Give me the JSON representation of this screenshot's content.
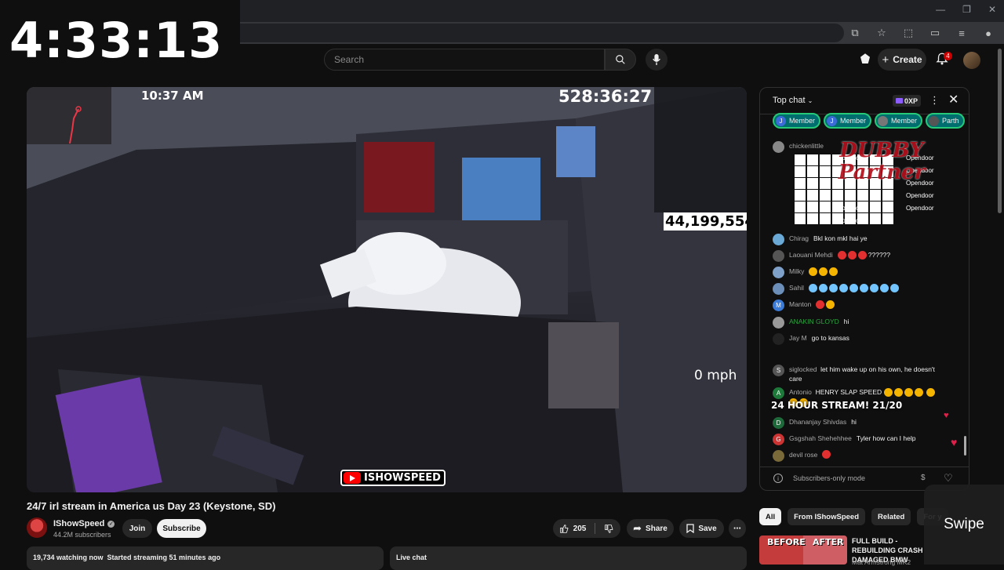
{
  "timer": "4:33:13",
  "header": {
    "search_placeholder": "Search",
    "create_label": "Create",
    "notification_count": "4"
  },
  "video": {
    "clock": "10:37 AM",
    "uptime": "528:36:27",
    "counter": "44,199,554",
    "speed": "0 mph",
    "logo_text": "ISHOWSPEED",
    "title": "24/7 irl stream in America us Day 23 (Keystone, SD)"
  },
  "channel": {
    "name": "IShowSpeed",
    "subscribers": "44.2M subscribers",
    "join_label": "Join",
    "subscribe_label": "Subscribe"
  },
  "actions": {
    "like_count": "205",
    "share_label": "Share",
    "save_label": "Save"
  },
  "description": {
    "stats": "19,734 watching now  Started streaming 51 minutes ago"
  },
  "livechat_label": "Live chat",
  "chat": {
    "title": "Top chat",
    "xp": "0XP",
    "chips": [
      "Member",
      "Member",
      "Member",
      "Parth"
    ],
    "messages": [
      {
        "author": "chickenlittle",
        "text": ""
      },
      {
        "author": "Chirag",
        "text": "Bkl kon mkl hai ye"
      },
      {
        "author": "Laouani Mehdi",
        "text": "??????"
      },
      {
        "author": "Milky",
        "text": ""
      },
      {
        "author": "Sahil",
        "text": ""
      },
      {
        "author": "Manton",
        "text": ""
      },
      {
        "author": "ANAKIN GLOYD",
        "text": "hi"
      },
      {
        "author": "Jay M",
        "text": "go to kansas"
      },
      {
        "author": "siglocked",
        "text": "let him wake up on his own, he doesn't care"
      },
      {
        "author": "Antonio",
        "text": "HENRY SLAP SPEED"
      },
      {
        "author": "Dhananjay Shivdas",
        "text": "hi"
      },
      {
        "author": "Gsgshah Shehehhee",
        "text": "Tyler how can I help"
      },
      {
        "author": "devil rose",
        "text": ""
      }
    ],
    "opendoor": "Opendoor",
    "partner_art": "DUBBY Partner",
    "banner": "24 HOUR STREAM! 21/20",
    "footer": "Subscribers-only mode"
  },
  "related": {
    "chips": [
      "All",
      "From IShowSpeed",
      "Related",
      "For y"
    ],
    "thumb_left": "BEFORE",
    "thumb_right": "AFTER",
    "title": "FULL BUILD - REBUILDING CRASH DAMAGED BMW",
    "channel": "Mat Armstrong MK2"
  },
  "swipe_label": "Swipe",
  "colors": {
    "accent": "#ff0000",
    "member_chip": "#006d6f",
    "page_bg": "#0f0f0f"
  }
}
